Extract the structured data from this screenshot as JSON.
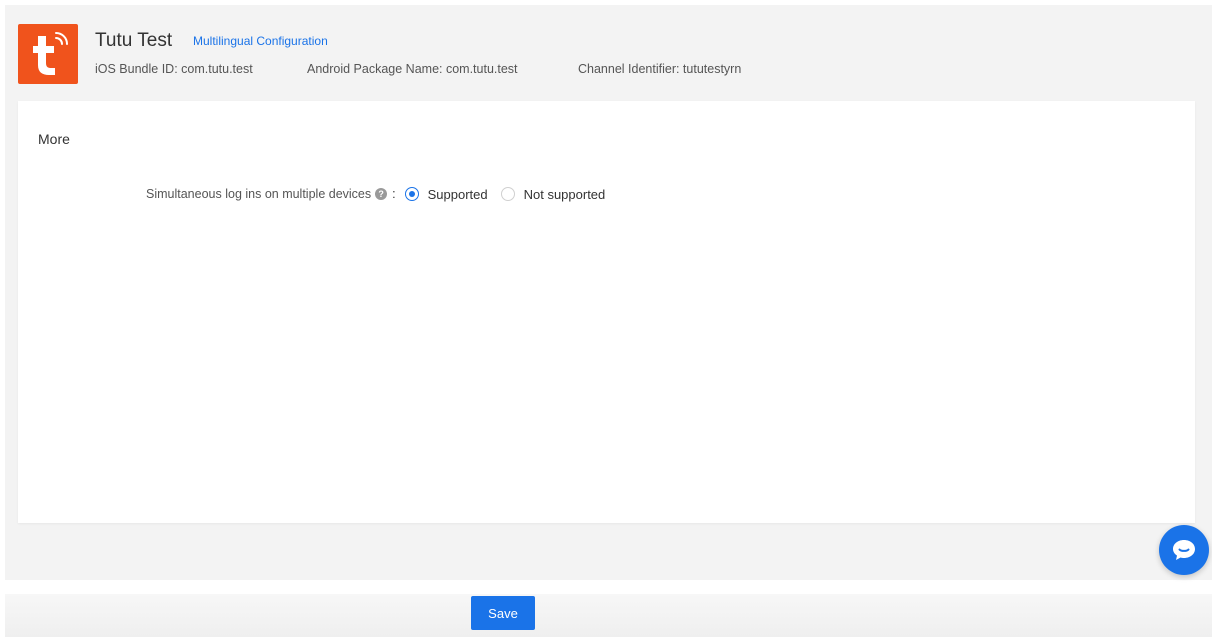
{
  "app": {
    "name": "Tutu Test",
    "multilingual_link": "Multilingual Configuration",
    "ios_bundle": "iOS Bundle ID: com.tutu.test",
    "android_package": "Android Package Name: com.tutu.test",
    "channel_id": "Channel Identifier: tututestyrn",
    "brand_color": "#f0531c",
    "logo_icon": "tuya-t-logo"
  },
  "section": {
    "title": "More"
  },
  "setting": {
    "label": "Simultaneous log ins on multiple devices",
    "help_icon": "question-circle-icon",
    "colon": ":",
    "options": [
      {
        "label": "Supported",
        "checked": true
      },
      {
        "label": "Not supported",
        "checked": false
      }
    ]
  },
  "chat": {
    "icon": "chat-bubble-icon"
  },
  "footer": {
    "save_label": "Save"
  },
  "colors": {
    "accent": "#1a73e8",
    "background": "#f3f3f3"
  }
}
